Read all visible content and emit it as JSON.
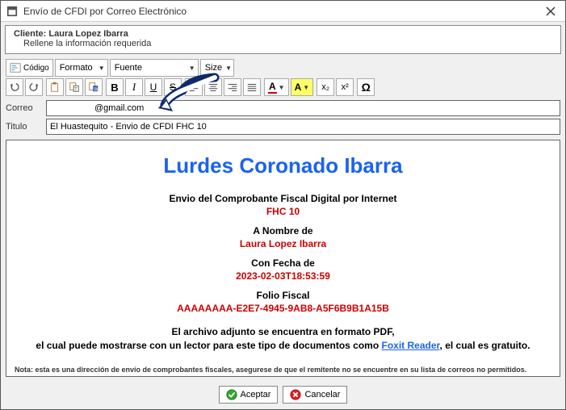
{
  "window": {
    "title": "Envío de CFDI por Correo Electrónico"
  },
  "banner": {
    "client_label": "Cliente:",
    "client_name": "Laura Lopez Ibarra",
    "hint": "Rellene la información requerida"
  },
  "toolbar": {
    "code_label": "Código",
    "format_label": "Formato",
    "font_label": "Fuente",
    "size_label": "Size",
    "bold": "B",
    "italic": "I",
    "underline": "U",
    "strike": "S",
    "sub": "x₂",
    "sup": "x²",
    "omega": "Ω",
    "highlight": "A"
  },
  "form": {
    "email_label": "Correo",
    "email_value": "                  @gmail.com",
    "title_label": "Titulo",
    "title_value": "El Huastequito - Envio de CFDI FHC 10"
  },
  "body": {
    "recipient_name": "Lurdes Coronado Ibarra",
    "doc_header": "Envio del Comprobante Fiscal Digital por Internet",
    "doc_folio": "FHC 10",
    "on_behalf_label": "A Nombre de",
    "on_behalf_value": "Laura Lopez Ibarra",
    "date_label": "Con Fecha de",
    "date_value": "2023-02-03T18:53:59",
    "folio_label": "Folio Fiscal",
    "folio_value": "AAAAAAAA-E2E7-4945-9AB8-A5F6B9B1A15B",
    "desc_line1": "El archivo adjunto se encuentra en formato PDF,",
    "desc_line2_a": "el cual puede mostrarse con un lector para este tipo de documentos como ",
    "desc_link": "Foxit Reader",
    "desc_line2_b": ", el cual es gratuito.",
    "note": "Nota: esta es una dirección de envío de comprobantes fiscales, asegurese de que el remitente no se encuentre en su lista de correos no permitidos."
  },
  "buttons": {
    "accept": "Aceptar",
    "cancel": "Cancelar"
  }
}
